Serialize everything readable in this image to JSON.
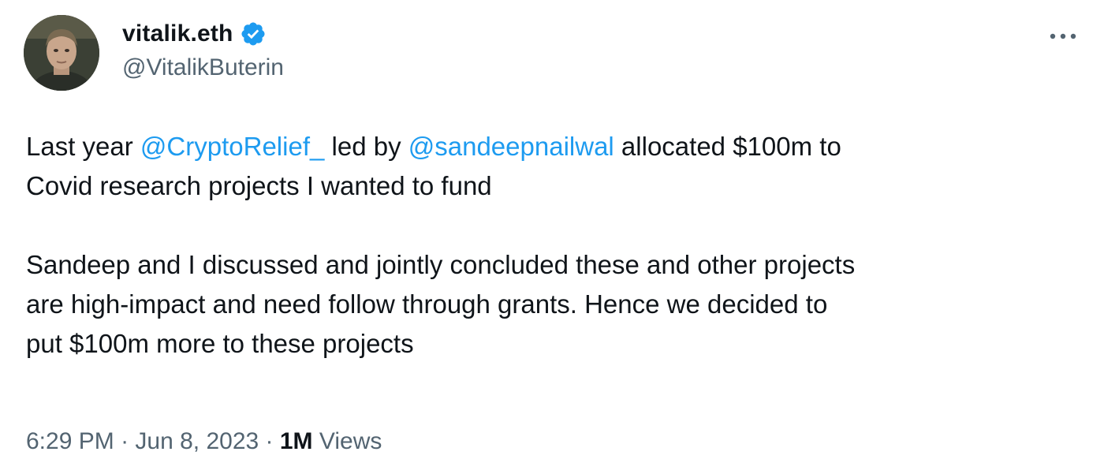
{
  "author": {
    "display_name": "vitalik.eth",
    "handle": "@VitalikButerin",
    "verified": true,
    "avatar_icon": "user-avatar",
    "verified_icon": "verified-badge-icon"
  },
  "menu": {
    "icon": "more-options-icon"
  },
  "tweet": {
    "para1": {
      "line1_pre": "Last year ",
      "mention1": "@CryptoRelief_",
      "line1_mid": " led by ",
      "mention2": "@sandeepnailwal",
      "line1_post": " allocated $100m to",
      "line2": "Covid research projects I wanted to fund"
    },
    "para2": {
      "line1": "Sandeep and I discussed and jointly concluded these and other projects",
      "line2": "are high-impact and need follow through grants. Hence we decided to",
      "line3": "put $100m more to these projects"
    }
  },
  "meta": {
    "time": "6:29 PM",
    "separator": " · ",
    "date": "Jun 8, 2023",
    "views_count": "1M",
    "views_label": " Views"
  },
  "colors": {
    "text": "#0f1419",
    "secondary": "#536471",
    "accent": "#1d9bf0",
    "background": "#ffffff"
  }
}
